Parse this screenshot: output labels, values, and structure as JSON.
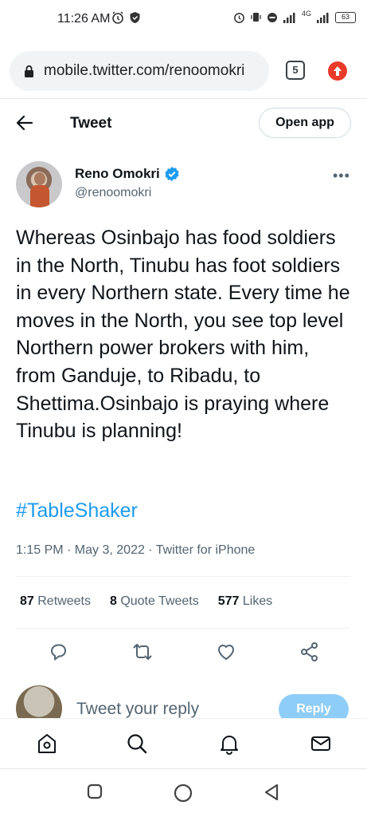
{
  "status_bar": {
    "time": "11:26 AM",
    "network_label": "4G",
    "battery": "63"
  },
  "browser": {
    "url": "mobile.twitter.com/renoomokri",
    "tab_count": "5"
  },
  "header": {
    "title": "Tweet",
    "open_app_label": "Open app"
  },
  "tweet": {
    "author_name": "Reno Omokri",
    "author_handle": "@renoomokri",
    "verified": true,
    "text": "Whereas Osinbajo has food soldiers in the North, Tinubu has foot soldiers in every Northern state. Every time he moves in the North, you see top level Northern power brokers with him, from Ganduje, to Ribadu, to Shettima.Osinbajo is praying where Tinubu is planning!",
    "hashtag": "#TableShaker",
    "meta": "1:15 PM · May 3, 2022 · Twitter for iPhone",
    "stats": {
      "retweets_count": "87",
      "retweets_label": "Retweets",
      "quotes_count": "8",
      "quotes_label": "Quote Tweets",
      "likes_count": "577",
      "likes_label": "Likes"
    }
  },
  "reply": {
    "placeholder": "Tweet your reply",
    "button_label": "Reply"
  },
  "colors": {
    "accent": "#1d9bf0",
    "text": "#0f1419",
    "secondary_text": "#536471",
    "reply_button": "#8ecdf8",
    "update_badge": "#ea3a2a"
  },
  "icons": {
    "bottom_nav": [
      "home-icon",
      "search-icon",
      "notifications-icon",
      "messages-icon"
    ],
    "actions": [
      "reply-icon",
      "retweet-icon",
      "like-icon",
      "share-icon"
    ],
    "system_nav": [
      "recents-icon",
      "home-circle-icon",
      "back-triangle-icon"
    ]
  }
}
